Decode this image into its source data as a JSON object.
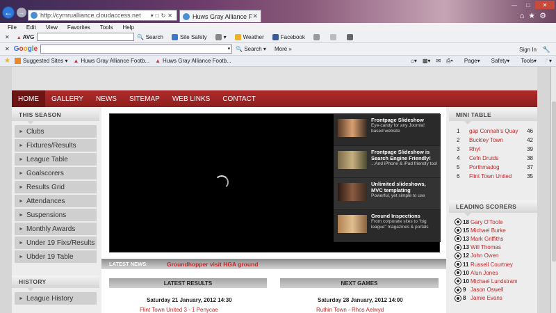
{
  "browser": {
    "url": "http://cymrualliance.cloudaccess.net",
    "tab_title": "Huws Gray Alliance Football...",
    "menu": [
      "File",
      "Edit",
      "View",
      "Favorites",
      "Tools",
      "Help"
    ],
    "avg": {
      "logo": "AVG",
      "search_label": "Search",
      "site_safety": "Site Safety",
      "weather": "Weather",
      "facebook": "Facebook"
    },
    "google": {
      "search_label": "Search",
      "more_label": "More »",
      "signin": "Sign In"
    },
    "favorites": {
      "suggested": "Suggested Sites",
      "fav1": "Huws Gray Alliance Footb...",
      "fav2": "Huws Gray Alliance Footb..."
    },
    "commands": {
      "page": "Page",
      "safety": "Safety",
      "tools": "Tools"
    }
  },
  "site": {
    "nav": [
      "HOME",
      "GALLERY",
      "NEWS",
      "SITEMAP",
      "WEB LINKS",
      "CONTACT"
    ],
    "this_season": {
      "heading": "THIS SEASON",
      "items": [
        "Clubs",
        "Fixtures/Results",
        "League Table",
        "Goalscorers",
        "Results Grid",
        "Attendances",
        "Suspensions",
        "Monthly Awards",
        "Under 19 Fixs/Results",
        "Ubder 19 Table"
      ]
    },
    "history": {
      "heading": "HISTORY",
      "items": [
        "League History"
      ]
    },
    "slides": [
      {
        "title": "Frontpage Slideshow",
        "desc": "Eye-candy for any Joomla! based website"
      },
      {
        "title": "Frontpage Slideshow is Search Engine Friendly!",
        "desc": "...And iPhone & iPad friendly too!"
      },
      {
        "title": "Unlimited slideshows, MVC templating",
        "desc": "Powerful, yet simple to use"
      },
      {
        "title": "Ground Inspections",
        "desc": "From corporate sites to \"big league\" magazines & portals"
      }
    ],
    "latest_news": {
      "label": "LATEST NEWS:",
      "text": "Groundhopper visit HGA ground"
    },
    "latest_results": {
      "heading": "LATEST RESULTS",
      "date": "Saturday 21 January, 2012 14:30",
      "row": "Flint Town United    3 - 1    Penycae"
    },
    "next_games": {
      "heading": "NEXT GAMES",
      "date": "Saturday 28 January, 2012 14:00",
      "row": "Ruthin Town  -  Rhos Aelwyd"
    },
    "mini_table": {
      "heading": "MINI TABLE",
      "rows": [
        {
          "pos": "1",
          "team": "gap Connah's Quay",
          "pts": "46"
        },
        {
          "pos": "2",
          "team": "Buckley Town",
          "pts": "42"
        },
        {
          "pos": "3",
          "team": "Rhyl",
          "pts": "39"
        },
        {
          "pos": "4",
          "team": "Cefn Druids",
          "pts": "38"
        },
        {
          "pos": "5",
          "team": "Porthmadog",
          "pts": "37"
        },
        {
          "pos": "6",
          "team": "Flint Town United",
          "pts": "35"
        }
      ]
    },
    "leading_scorers": {
      "heading": "LEADING SCORERS",
      "rows": [
        {
          "goals": "18",
          "name": "Gary O'Toole"
        },
        {
          "goals": "15",
          "name": "Michael Burke"
        },
        {
          "goals": "13",
          "name": "Mark Griffiths"
        },
        {
          "goals": "13",
          "name": "Will Thomas"
        },
        {
          "goals": "12",
          "name": "John Owen"
        },
        {
          "goals": "11",
          "name": "Russell Courtney"
        },
        {
          "goals": "10",
          "name": "Alun Jones"
        },
        {
          "goals": "10",
          "name": "Michael Lundstram"
        },
        {
          "goals": "9",
          "name": "Jason Oswell"
        },
        {
          "goals": "8",
          "name": "Jamie Evans"
        }
      ]
    }
  },
  "colors": {
    "brand_red": "#a82424",
    "link_red": "#c0282a"
  }
}
